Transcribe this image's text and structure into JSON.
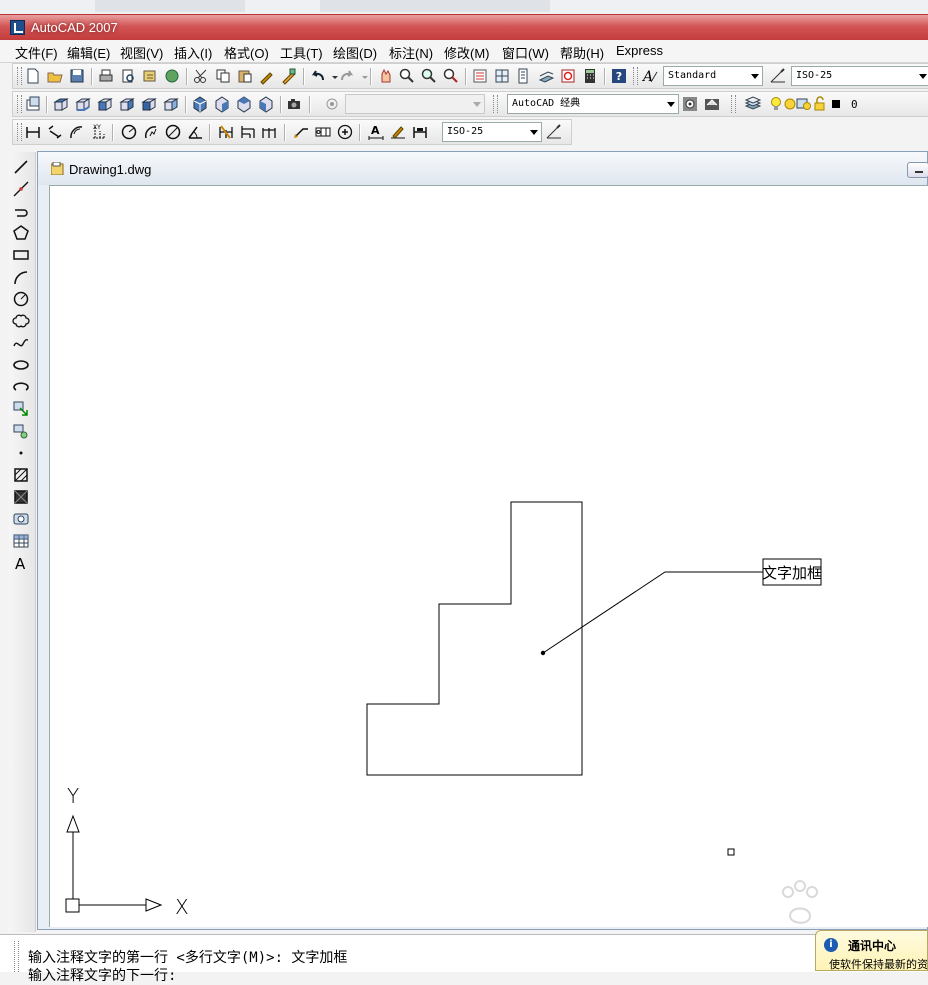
{
  "window": {
    "title": "AutoCAD 2007"
  },
  "menu": [
    "文件(F)",
    "编辑(E)",
    "视图(V)",
    "插入(I)",
    "格式(O)",
    "工具(T)",
    "绘图(D)",
    "标注(N)",
    "修改(M)",
    "窗口(W)",
    "帮助(H)",
    "Express"
  ],
  "toolbar": {
    "text_style": "Standard",
    "dim_style": "ISO-25",
    "view_combo": "",
    "workspace": "AutoCAD 经典",
    "layer": "0",
    "dim_style_2": "ISO-25"
  },
  "drawing": {
    "tab_name": "Drawing1.dwg",
    "leader_text": "文字加框",
    "ucs_x": "X",
    "ucs_y": "Y"
  },
  "command_line": {
    "line1": "输入注释文字的第一行 <多行文字(M)>: 文字加框",
    "line2": "输入注释文字的下一行:"
  },
  "comm_center": {
    "title": "通讯中心",
    "subtitle": "使软件保持最新的资"
  },
  "colors": {
    "titlebar": "#c43c3c",
    "canvas": "#ffffff",
    "comm_bg": "#fff3b5"
  }
}
